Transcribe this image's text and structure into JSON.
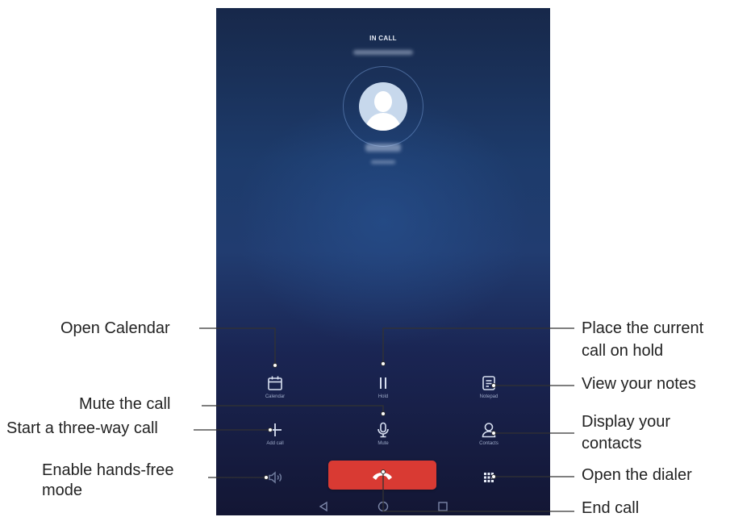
{
  "status": {
    "in_call_label": "IN CALL"
  },
  "buttons": {
    "calendar": "Calendar",
    "hold": "Hold",
    "notepad": "Notepad",
    "add_call": "Add call",
    "mute": "Mute",
    "contacts": "Contacts"
  },
  "callouts": {
    "open_calendar": "Open Calendar",
    "mute_call": "Mute the call",
    "three_way": "Start a three-way call",
    "hands_free_1": "Enable hands-free",
    "hands_free_2": "mode",
    "hold_1": "Place the current",
    "hold_2": "call on hold",
    "notes": "View your notes",
    "contacts_1": "Display your",
    "contacts_2": "contacts",
    "dialer": "Open the dialer",
    "end_call": "End call"
  },
  "colors": {
    "end_call_button": "#d93a33",
    "callout_line": "#333333"
  },
  "icons": [
    "calendar-icon",
    "pause-icon",
    "notepad-icon",
    "plus-icon",
    "microphone-icon",
    "person-icon",
    "speaker-icon",
    "dialpad-icon",
    "phone-hangup-icon",
    "back-icon",
    "home-icon",
    "recents-icon"
  ]
}
